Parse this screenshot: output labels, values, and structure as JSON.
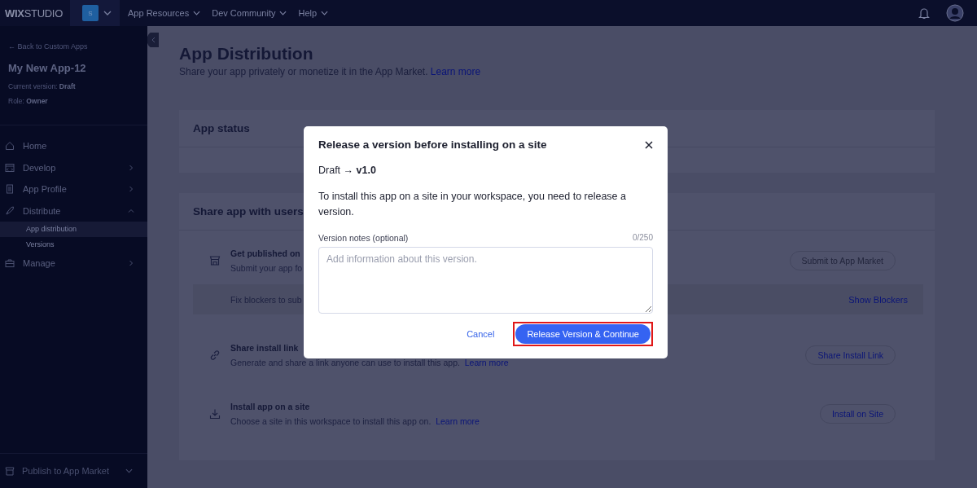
{
  "topbar": {
    "logo": "**WIX**STUDIO",
    "site_badge": "S",
    "menus": [
      {
        "label": "App Resources"
      },
      {
        "label": "Dev Community"
      },
      {
        "label": "Help"
      }
    ]
  },
  "sidebar": {
    "back_link": "← Back to Custom Apps",
    "app_name": "My New App-12",
    "current_version": {
      "label": "Current version:",
      "value": "Draft"
    },
    "role": {
      "label": "Role:",
      "value": "Owner"
    },
    "items": [
      {
        "kind": "home",
        "label": "Home",
        "has_children": false
      },
      {
        "kind": "develop",
        "label": "Develop",
        "expanded": false,
        "has_children": true
      },
      {
        "kind": "profile",
        "label": "App Profile",
        "expanded": false,
        "has_children": true
      },
      {
        "kind": "distribute",
        "label": "Distribute",
        "expanded": true,
        "has_children": true,
        "children": [
          {
            "label": "App distribution",
            "selected": true
          },
          {
            "label": "Versions",
            "selected": false
          }
        ]
      },
      {
        "kind": "manage",
        "label": "Manage",
        "expanded": false,
        "has_children": true
      }
    ],
    "footer": "Publish to App Market"
  },
  "main": {
    "title": "App Distribution",
    "subtitle": "Share your app privately or monetize it in the App Market.",
    "subtitle_link": "Learn more",
    "status_card": {
      "title": "App status"
    },
    "share_card": {
      "title": "Share app with users",
      "options": [
        {
          "kind": "market",
          "title": "Get published on",
          "description": "Submit your app fo",
          "button": "Submit to App Market",
          "disabled": true,
          "blocker": {
            "text": "Fix blockers to sub",
            "button": "Show Blockers"
          }
        },
        {
          "kind": "link",
          "title": "Share install link",
          "description": "Generate and share a link anyone can use to install this app.",
          "link": "Learn more",
          "button": "Share Install Link",
          "disabled": false
        },
        {
          "kind": "install",
          "title": "Install app on a site",
          "description": "Choose a site in this workspace to install this app on.",
          "link": "Learn more",
          "button": "Install on Site",
          "disabled": false
        }
      ]
    }
  },
  "modal": {
    "title": "Release a version before installing on a site",
    "transition": "Draft → **v1.0**",
    "body": "To install this app on a site in your workspace, you need to release a version.",
    "field_label": "Version notes (optional)",
    "counter": "0/250",
    "placeholder": "Add information about this version.",
    "cancel": "Cancel",
    "primary": "Release Version & Continue",
    "highlighted": true
  }
}
